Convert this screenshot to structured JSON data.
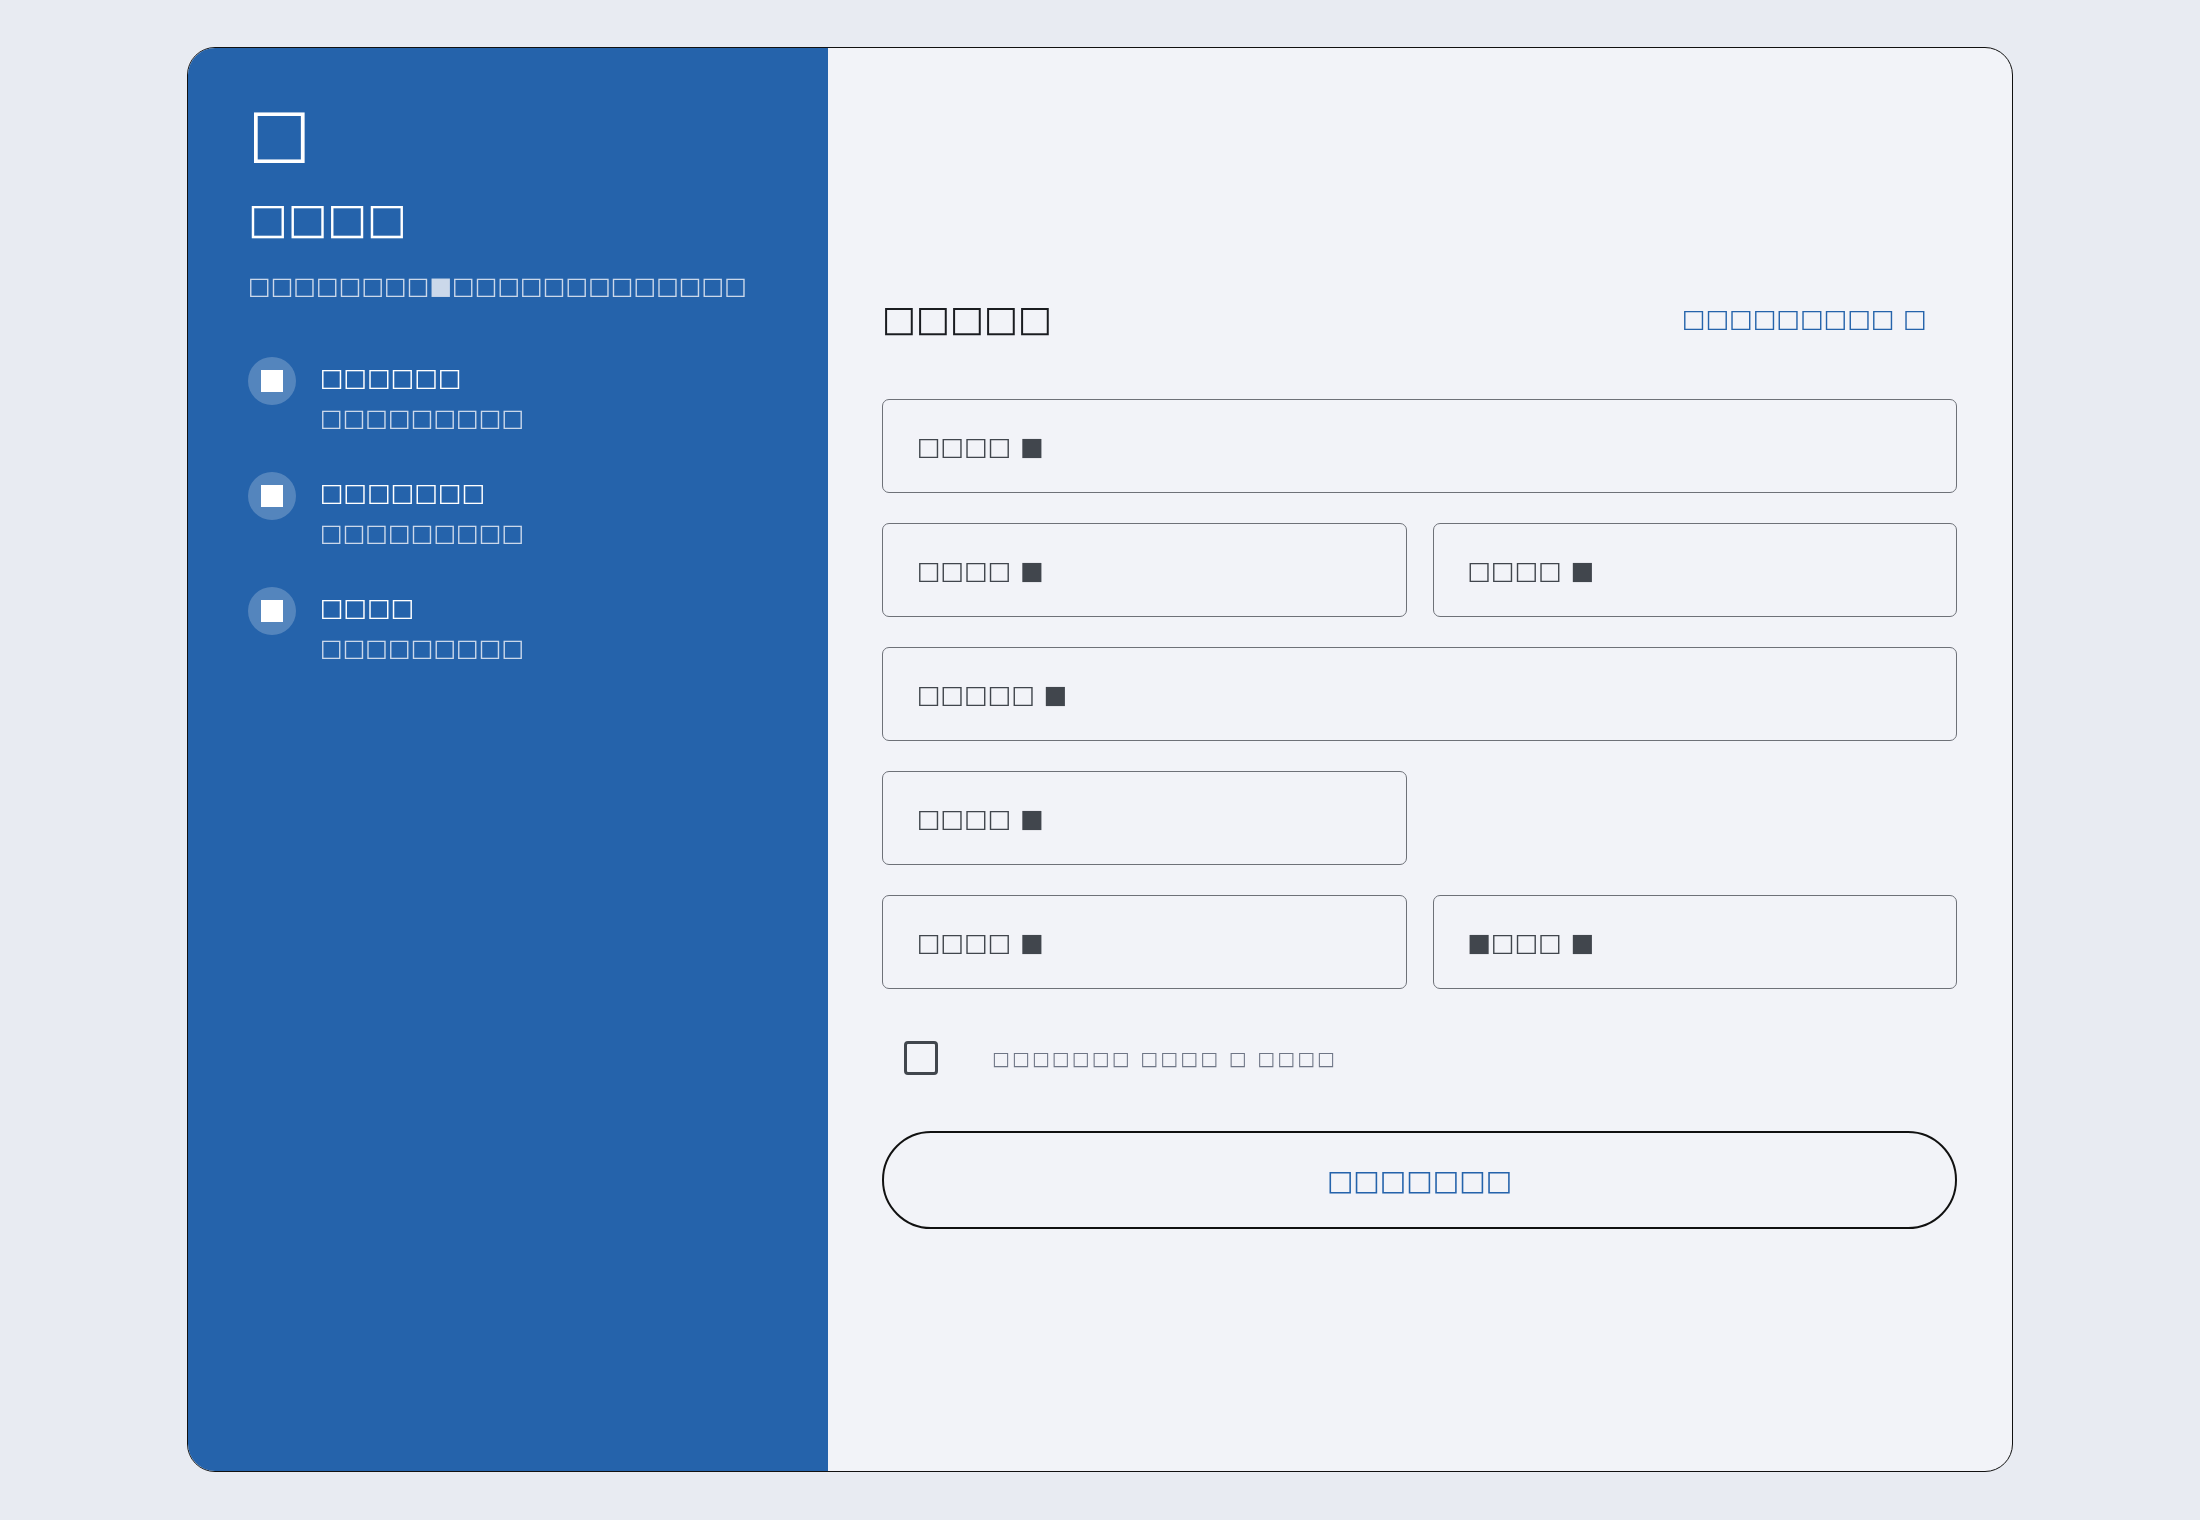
{
  "sidebar": {
    "logo": "□",
    "title": "□□□□",
    "description": "□□□□□□□□■□□□□□□□□□□□□□",
    "features": [
      {
        "title": "□□□□□□",
        "subtitle": "□□□□□□□□□"
      },
      {
        "title": "□□□□□□□",
        "subtitle": "□□□□□□□□□"
      },
      {
        "title": "□□□□",
        "subtitle": "□□□□□□□□□"
      }
    ]
  },
  "form": {
    "heading": "□□□□□",
    "link": "□□□□□□□□□ □",
    "rows": [
      [
        {
          "placeholder": "□□□□ ■"
        }
      ],
      [
        {
          "placeholder": "□□□□ ■"
        },
        {
          "placeholder": "□□□□ ■"
        }
      ],
      [
        {
          "placeholder": "□□□□□ ■"
        }
      ],
      [
        {
          "placeholder": "□□□□ ■"
        }
      ],
      [
        {
          "placeholder": "□□□□ ■"
        },
        {
          "placeholder": "■□□□ ■"
        }
      ]
    ],
    "checkbox": {
      "label": "□□□□□□□ □□□□ □ □□□□",
      "checked": false
    },
    "submit": "□□□□□□□"
  }
}
